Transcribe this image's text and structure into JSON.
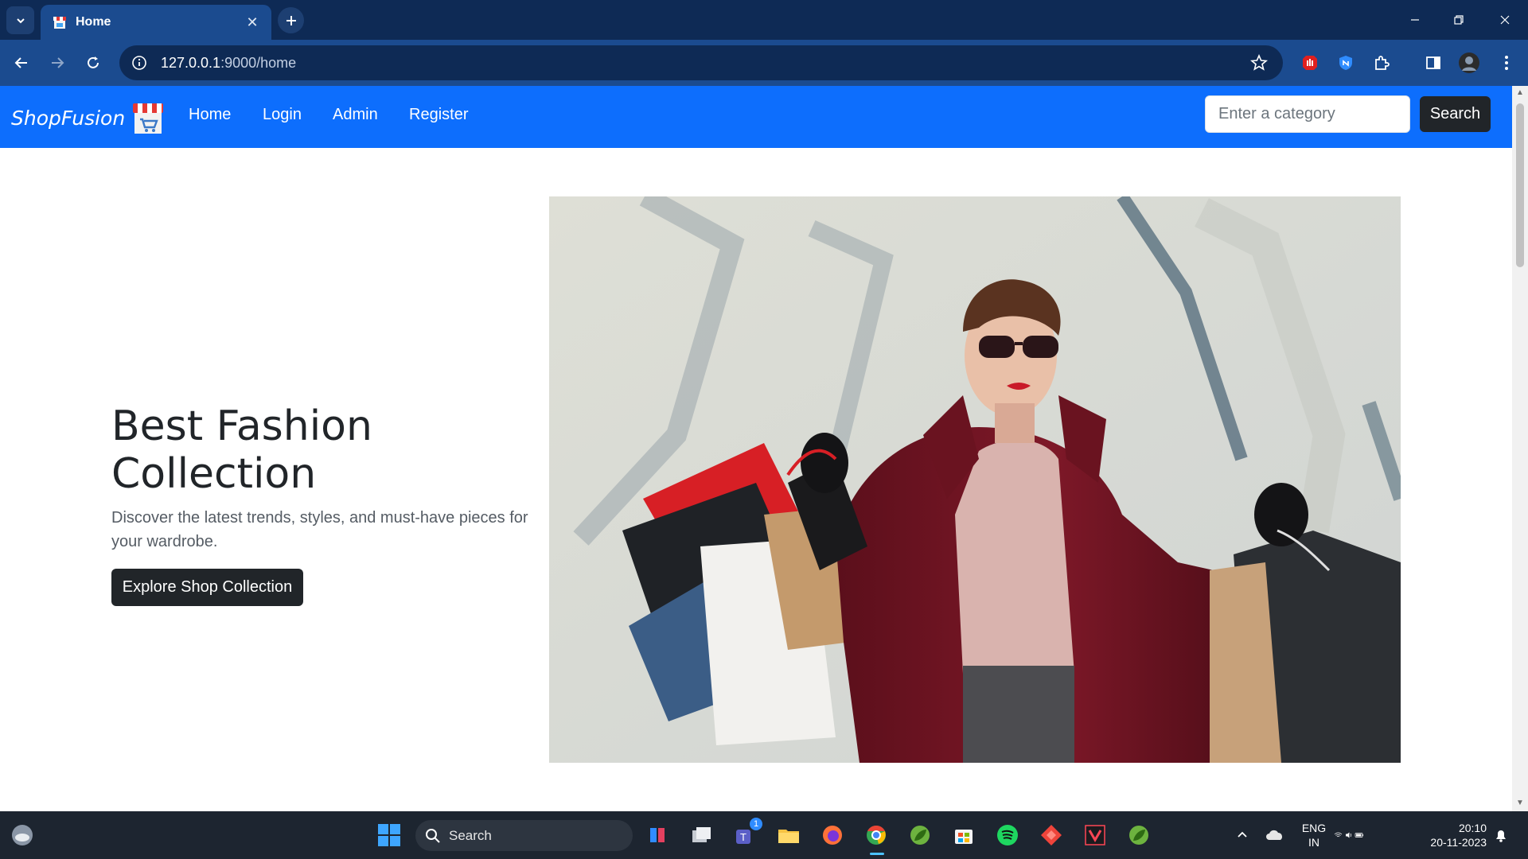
{
  "browser": {
    "tab_title": "Home",
    "url_host": "127.0.0.1",
    "url_path": ":9000/home"
  },
  "site": {
    "brand": "ShopFusion",
    "nav_links": [
      "Home",
      "Login",
      "Admin",
      "Register"
    ],
    "search_placeholder": "Enter a category",
    "search_button": "Search"
  },
  "hero": {
    "title_line1": "Best Fashion",
    "title_line2": "Collection",
    "subtitle": "Discover the latest trends, styles, and must-have pieces for your wardrobe.",
    "button": "Explore Shop Collection"
  },
  "taskbar": {
    "search_label": "Search",
    "teams_badge": "1",
    "language_line1": "ENG",
    "language_line2": "IN",
    "time": "20:10",
    "date": "20-11-2023"
  },
  "colors": {
    "navbar": "#0d6efd",
    "dark_button": "#212529",
    "chrome_frame": "#0e2a55",
    "chrome_toolbar": "#1b4b8f",
    "taskbar": "#1d2530"
  }
}
